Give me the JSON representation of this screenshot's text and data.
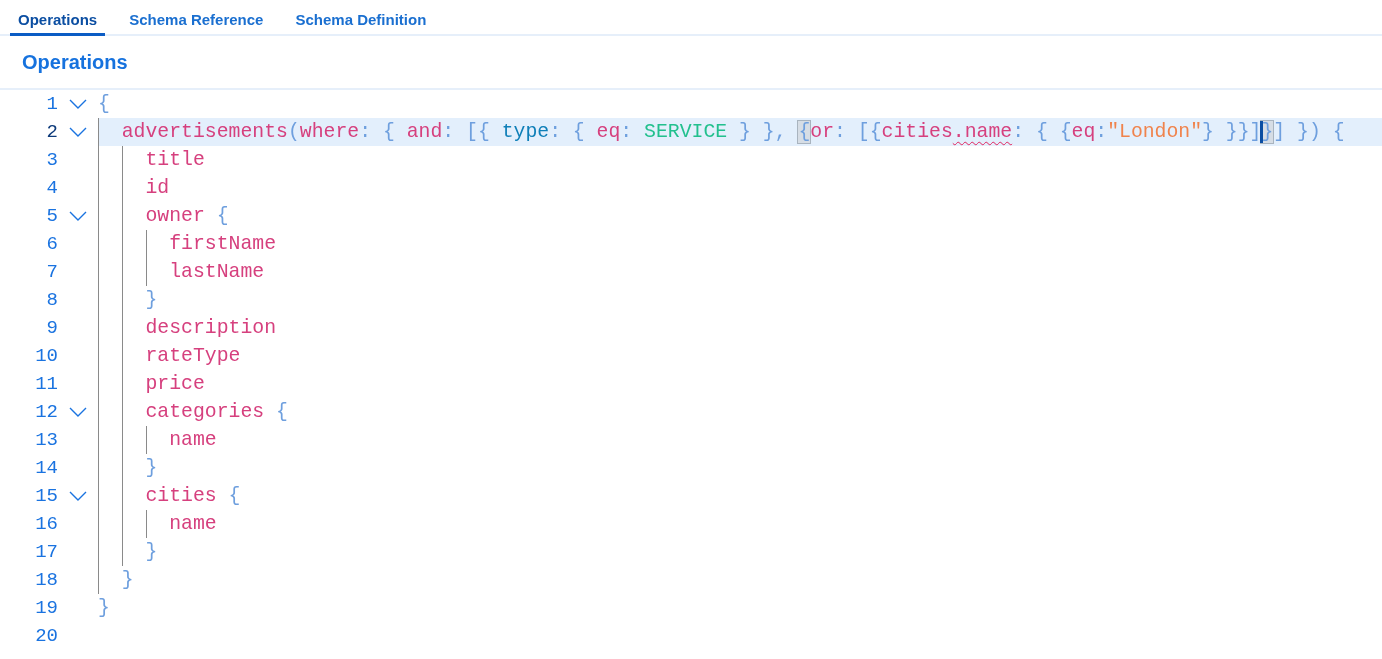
{
  "tabs": [
    {
      "label": "Operations",
      "selected": true
    },
    {
      "label": "Schema Reference",
      "selected": false
    },
    {
      "label": "Schema Definition",
      "selected": false
    }
  ],
  "section_title": "Operations",
  "editor": {
    "lines": [
      {
        "number": "1",
        "foldable": true,
        "current": false,
        "tokens": [
          {
            "kind": "punct",
            "text": "{"
          }
        ]
      },
      {
        "number": "2",
        "foldable": true,
        "current": true,
        "tokens": [
          {
            "kind": "field",
            "text": "  advertisements"
          },
          {
            "kind": "punct",
            "text": "("
          },
          {
            "kind": "field",
            "text": "where"
          },
          {
            "kind": "punct",
            "text": ": { "
          },
          {
            "kind": "field",
            "text": "and"
          },
          {
            "kind": "punct",
            "text": ": [{ "
          },
          {
            "kind": "type",
            "text": "type"
          },
          {
            "kind": "punct",
            "text": ": { "
          },
          {
            "kind": "field",
            "text": "eq"
          },
          {
            "kind": "punct",
            "text": ": "
          },
          {
            "kind": "enum",
            "text": "SERVICE"
          },
          {
            "kind": "punct",
            "text": " } }, "
          },
          {
            "kind": "match",
            "text": "{"
          },
          {
            "kind": "field",
            "text": "or"
          },
          {
            "kind": "punct",
            "text": ": [{"
          },
          {
            "kind": "field",
            "text": "cities"
          },
          {
            "kind": "error",
            "text": ".name"
          },
          {
            "kind": "punct",
            "text": ": { {"
          },
          {
            "kind": "field",
            "text": "eq"
          },
          {
            "kind": "punct",
            "text": ":"
          },
          {
            "kind": "string",
            "text": "\"London\""
          },
          {
            "kind": "punct",
            "text": "} }}]"
          },
          {
            "kind": "cursor"
          },
          {
            "kind": "match",
            "text": "}"
          },
          {
            "kind": "punct",
            "text": "] }) {"
          }
        ]
      },
      {
        "number": "3",
        "foldable": false,
        "current": false,
        "tokens": [
          {
            "kind": "field",
            "text": "    title"
          }
        ]
      },
      {
        "number": "4",
        "foldable": false,
        "current": false,
        "tokens": [
          {
            "kind": "field",
            "text": "    id"
          }
        ]
      },
      {
        "number": "5",
        "foldable": true,
        "current": false,
        "tokens": [
          {
            "kind": "field",
            "text": "    owner "
          },
          {
            "kind": "punct",
            "text": "{"
          }
        ]
      },
      {
        "number": "6",
        "foldable": false,
        "current": false,
        "tokens": [
          {
            "kind": "field",
            "text": "      firstName"
          }
        ]
      },
      {
        "number": "7",
        "foldable": false,
        "current": false,
        "tokens": [
          {
            "kind": "field",
            "text": "      lastName"
          }
        ]
      },
      {
        "number": "8",
        "foldable": false,
        "current": false,
        "tokens": [
          {
            "kind": "punct",
            "text": "    }"
          }
        ]
      },
      {
        "number": "9",
        "foldable": false,
        "current": false,
        "tokens": [
          {
            "kind": "field",
            "text": "    description"
          }
        ]
      },
      {
        "number": "10",
        "foldable": false,
        "current": false,
        "tokens": [
          {
            "kind": "field",
            "text": "    rateType"
          }
        ]
      },
      {
        "number": "11",
        "foldable": false,
        "current": false,
        "tokens": [
          {
            "kind": "field",
            "text": "    price"
          }
        ]
      },
      {
        "number": "12",
        "foldable": true,
        "current": false,
        "tokens": [
          {
            "kind": "field",
            "text": "    categories "
          },
          {
            "kind": "punct",
            "text": "{"
          }
        ]
      },
      {
        "number": "13",
        "foldable": false,
        "current": false,
        "tokens": [
          {
            "kind": "field",
            "text": "      name"
          }
        ]
      },
      {
        "number": "14",
        "foldable": false,
        "current": false,
        "tokens": [
          {
            "kind": "punct",
            "text": "    }"
          }
        ]
      },
      {
        "number": "15",
        "foldable": true,
        "current": false,
        "tokens": [
          {
            "kind": "field",
            "text": "    cities "
          },
          {
            "kind": "punct",
            "text": "{"
          }
        ]
      },
      {
        "number": "16",
        "foldable": false,
        "current": false,
        "tokens": [
          {
            "kind": "field",
            "text": "      name"
          }
        ]
      },
      {
        "number": "17",
        "foldable": false,
        "current": false,
        "tokens": [
          {
            "kind": "punct",
            "text": "    }"
          }
        ]
      },
      {
        "number": "18",
        "foldable": false,
        "current": false,
        "tokens": [
          {
            "kind": "punct",
            "text": "  }"
          }
        ]
      },
      {
        "number": "19",
        "foldable": false,
        "current": false,
        "tokens": [
          {
            "kind": "punct",
            "text": "}"
          }
        ]
      },
      {
        "number": "20",
        "foldable": false,
        "current": false
      }
    ]
  }
}
